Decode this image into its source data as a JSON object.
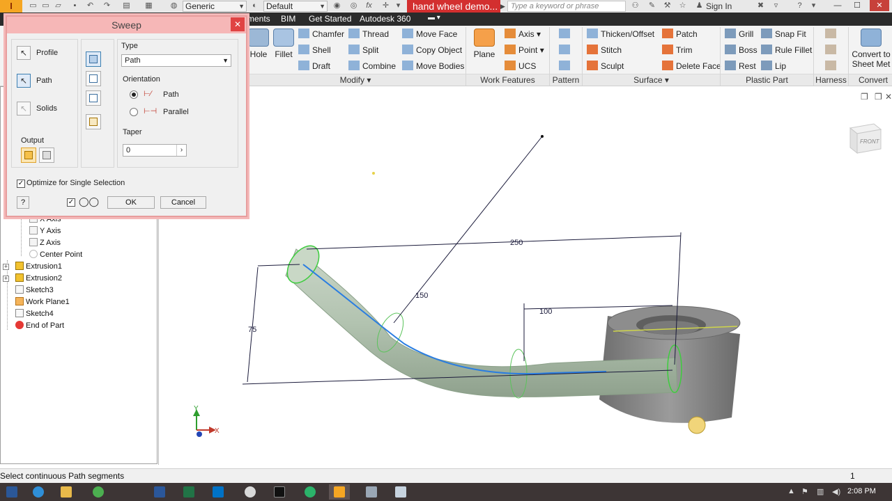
{
  "titlebar": {
    "app_logo": "I",
    "combo_material": "Generic",
    "combo_appearance": "Default",
    "doc_title": "hand wheel demo...",
    "search_placeholder": "Type a keyword or phrase",
    "sign_in": "Sign In",
    "icons": [
      "new-icon",
      "open-icon",
      "save-icon",
      "undo-icon",
      "redo-icon",
      "material-icon",
      "measure-icon",
      "color-icon",
      "fx-icon",
      "cross-icon",
      "binoculars-icon",
      "wrench-icon",
      "star-icon",
      "user-icon",
      "exchange-icon",
      "help-icon"
    ]
  },
  "menubar": {
    "tabs": [
      "ments",
      "BIM",
      "Get Started",
      "Autodesk 360"
    ]
  },
  "ribbon": {
    "hole": "Hole",
    "fillet": "Fillet",
    "modify_col1": [
      "Chamfer",
      "Shell",
      "Draft"
    ],
    "modify_col2": [
      "Thread",
      "Split",
      "Combine"
    ],
    "modify_col3": [
      "Move Face",
      "Copy Object",
      "Move Bodies"
    ],
    "modify_label": "Modify",
    "plane": "Plane",
    "work_col": [
      "Axis",
      "Point",
      "UCS"
    ],
    "work_label": "Work Features",
    "pattern_label": "Pattern",
    "surface_col1": [
      "Thicken/Offset",
      "Stitch",
      "Sculpt"
    ],
    "surface_col2": [
      "Patch",
      "Trim",
      "Delete Face"
    ],
    "surface_label": "Surface",
    "plastic_col1": [
      "Grill",
      "Boss",
      "Rest"
    ],
    "plastic_col2": [
      "Snap Fit",
      "Rule Fillet",
      "Lip"
    ],
    "plastic_label": "Plastic Part",
    "harness_label": "Harness",
    "convert_line1": "Convert to",
    "convert_line2": "Sheet Met",
    "convert_label": "Convert"
  },
  "sweep_dialog": {
    "title": "Sweep",
    "profile": "Profile",
    "path": "Path",
    "solids": "Solids",
    "output": "Output",
    "type_label": "Type",
    "type_value": "Path",
    "orientation_label": "Orientation",
    "orient_path": "Path",
    "orient_parallel": "Parallel",
    "taper_label": "Taper",
    "taper_value": "0",
    "optimize": "Optimize for Single Selection",
    "ok": "OK",
    "cancel": "Cancel",
    "help": "?"
  },
  "browser": {
    "items": [
      "X Axis",
      "Y Axis",
      "Z Axis",
      "Center Point",
      "Extrusion1",
      "Extrusion2",
      "Sketch3",
      "Work Plane1",
      "Sketch4",
      "End of Part"
    ]
  },
  "viewport": {
    "dim_250": "250",
    "dim_150": "150",
    "dim_100": "100",
    "dim_75": "75",
    "viewcube_label": "FRONT",
    "axis_y": "Y",
    "axis_x": "X"
  },
  "statusbar": {
    "text": "Select continuous Path segments",
    "count": "1"
  },
  "taskbar": {
    "clock": "2:08 PM",
    "apps": [
      "ie-icon",
      "explorer-icon",
      "chrome-icon",
      "word-icon",
      "excel-icon",
      "outlook-icon",
      "paint-icon",
      "media-icon",
      "network-icon",
      "inventor-icon",
      "image-icon",
      "window-icon"
    ]
  },
  "colors": {
    "doc_title_bg": "#d32f2f",
    "dialog_title_bg": "#f6b7b7",
    "path_blue": "#2a7de1",
    "profile_green": "#3ecc3e",
    "tube_fill": "#b7c9b5"
  }
}
